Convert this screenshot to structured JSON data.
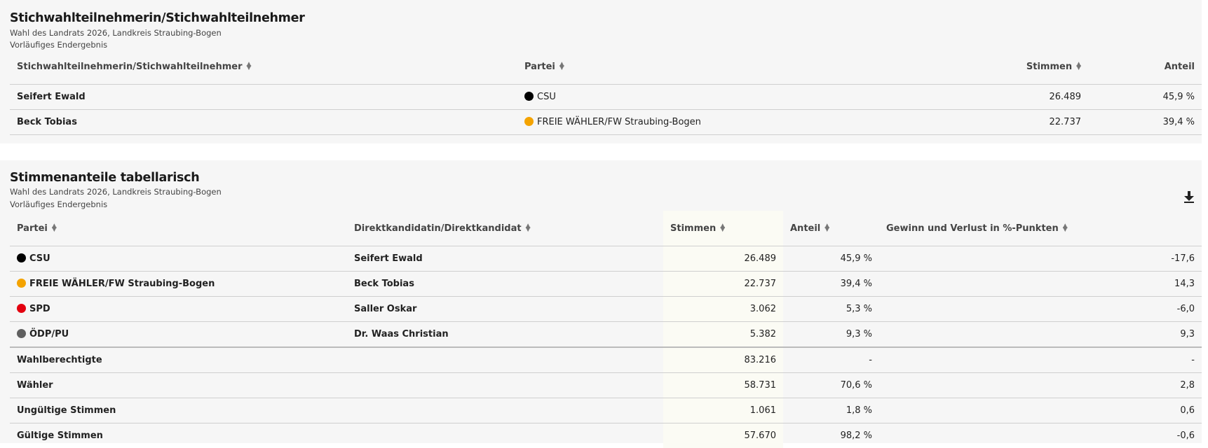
{
  "section1": {
    "title": "Stichwahlteilnehmerin/Stichwahlteilnehmer",
    "subtitle": "Wahl des Landrats 2026, Landkreis Straubing-Bogen",
    "status": "Vorläufiges Endergebnis",
    "headers": {
      "candidate": "Stichwahlteilnehmerin/Stichwahlteilnehmer",
      "party": "Partei",
      "votes": "Stimmen",
      "share": "Anteil"
    },
    "rows": [
      {
        "candidate": "Seifert Ewald",
        "party": "CSU",
        "party_color": "#000000",
        "votes": "26.489",
        "share": "45,9 %"
      },
      {
        "candidate": "Beck Tobias",
        "party": "FREIE WÄHLER/FW Straubing-Bogen",
        "party_color": "#f4a300",
        "votes": "22.737",
        "share": "39,4 %"
      }
    ]
  },
  "section2": {
    "title": "Stimmenanteile tabellarisch",
    "subtitle": "Wahl des Landrats 2026, Landkreis Straubing-Bogen",
    "status": "Vorläufiges Endergebnis",
    "download_icon": "download-icon",
    "headers": {
      "party": "Partei",
      "candidate": "Direktkandidatin/Direktkandidat",
      "votes": "Stimmen",
      "share": "Anteil",
      "change": "Gewinn und Verlust in %-Punkten"
    },
    "rows": [
      {
        "party": "CSU",
        "party_color": "#000000",
        "candidate": "Seifert Ewald",
        "votes": "26.489",
        "share": "45,9 %",
        "change": "-17,6"
      },
      {
        "party": "FREIE WÄHLER/FW Straubing-Bogen",
        "party_color": "#f4a300",
        "candidate": "Beck Tobias",
        "votes": "22.737",
        "share": "39,4 %",
        "change": "14,3"
      },
      {
        "party": "SPD",
        "party_color": "#e3000f",
        "candidate": "Saller Oskar",
        "votes": "3.062",
        "share": "5,3 %",
        "change": "-6,0"
      },
      {
        "party": "ÖDP/PU",
        "party_color": "#606060",
        "candidate": "Dr. Waas Christian",
        "votes": "5.382",
        "share": "9,3 %",
        "change": "9,3"
      }
    ],
    "summary": [
      {
        "label": "Wahlberechtigte",
        "votes": "83.216",
        "share": "-",
        "change": "-"
      },
      {
        "label": "Wähler",
        "votes": "58.731",
        "share": "70,6 %",
        "change": "2,8"
      },
      {
        "label": "Ungültige Stimmen",
        "votes": "1.061",
        "share": "1,8 %",
        "change": "0,6"
      },
      {
        "label": "Gültige Stimmen",
        "votes": "57.670",
        "share": "98,2 %",
        "change": "-0,6"
      }
    ]
  }
}
